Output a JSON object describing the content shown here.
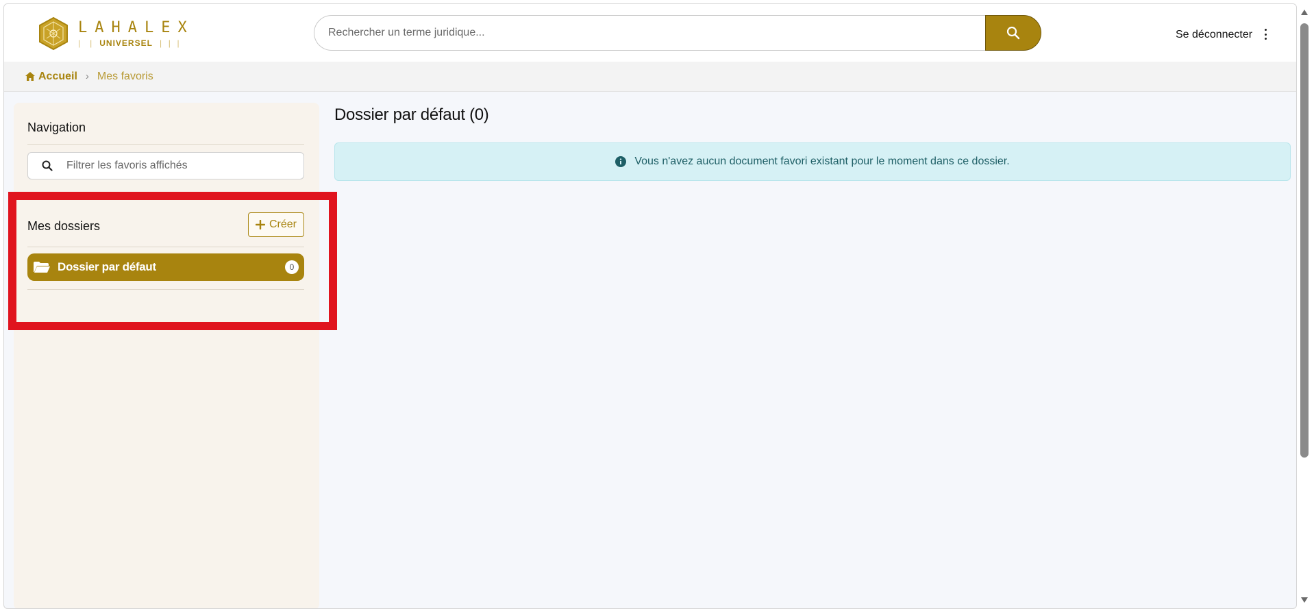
{
  "header": {
    "logo_word": "LAHALEX",
    "logo_sub": "UNIVERSEL",
    "search_placeholder": "Rechercher un terme juridique...",
    "logout_label": "Se déconnecter",
    "brand_color": "#a8840f"
  },
  "breadcrumb": {
    "home": "Accueil",
    "current": "Mes favoris"
  },
  "sidebar": {
    "nav_title": "Navigation",
    "filter_placeholder": "Filtrer les favoris affichés",
    "folders_title": "Mes dossiers",
    "create_label": "Créer",
    "folders": [
      {
        "label": "Dossier par défaut",
        "count": "0"
      }
    ]
  },
  "main": {
    "title": "Dossier par défaut (0)",
    "alert": "Vous n'avez aucun document favori existant pour le moment dans ce dossier."
  },
  "icons": [
    "search-icon",
    "home-icon",
    "chevron-right-icon",
    "kebab-menu-icon",
    "plus-icon",
    "folder-open-icon",
    "info-icon"
  ]
}
